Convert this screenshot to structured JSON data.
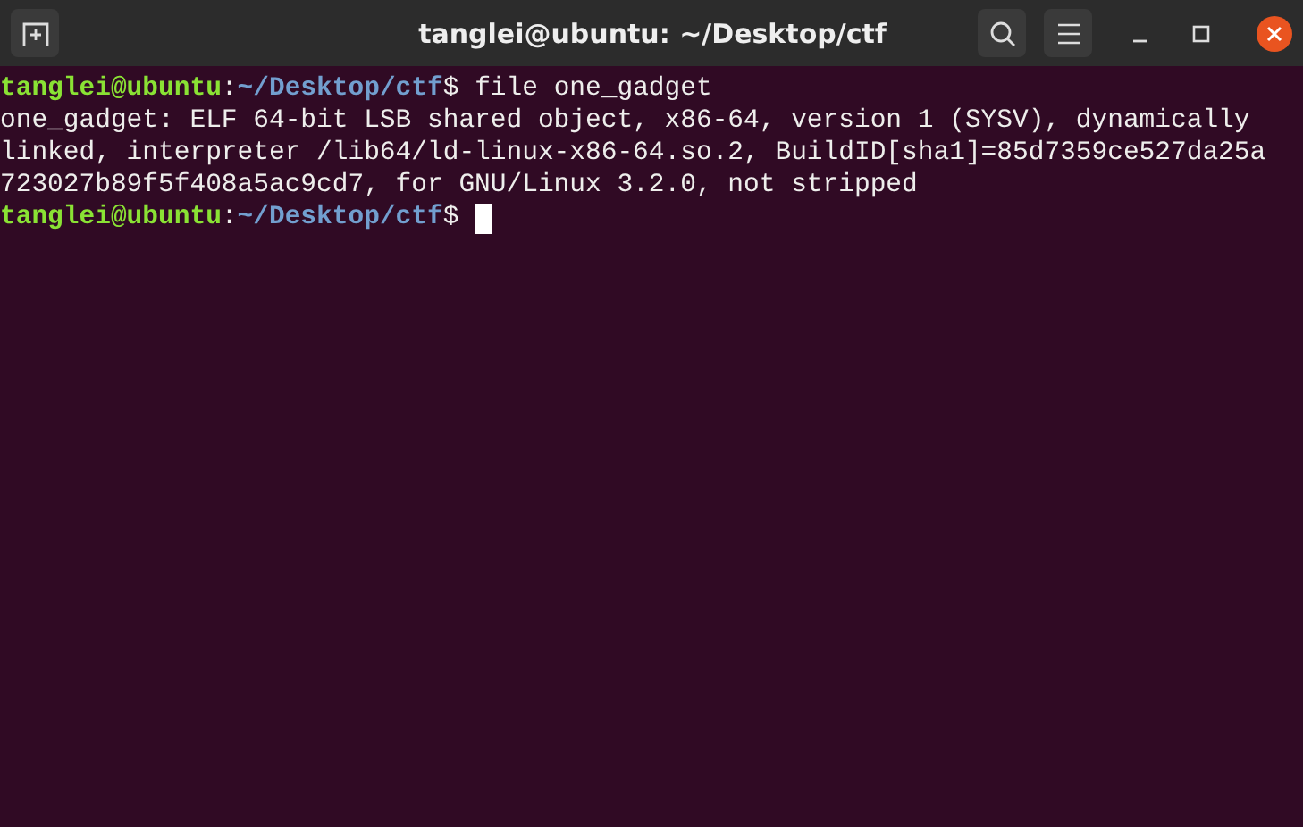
{
  "window": {
    "title": "tanglei@ubuntu: ~/Desktop/ctf"
  },
  "lines": [
    {
      "kind": "prompt",
      "user": "tanglei@ubuntu",
      "sep": ":",
      "path": "~/Desktop/ctf",
      "symbol": "$",
      "command": " file one_gadget",
      "cursor": false
    },
    {
      "kind": "output",
      "text": "one_gadget: ELF 64-bit LSB shared object, x86-64, version 1 (SYSV), dynamically"
    },
    {
      "kind": "output",
      "text": "linked, interpreter /lib64/ld-linux-x86-64.so.2, BuildID[sha1]=85d7359ce527da25a"
    },
    {
      "kind": "output",
      "text": "723027b89f5f408a5ac9cd7, for GNU/Linux 3.2.0, not stripped"
    },
    {
      "kind": "prompt",
      "user": "tanglei@ubuntu",
      "sep": ":",
      "path": "~/Desktop/ctf",
      "symbol": "$",
      "cursor": true
    }
  ]
}
